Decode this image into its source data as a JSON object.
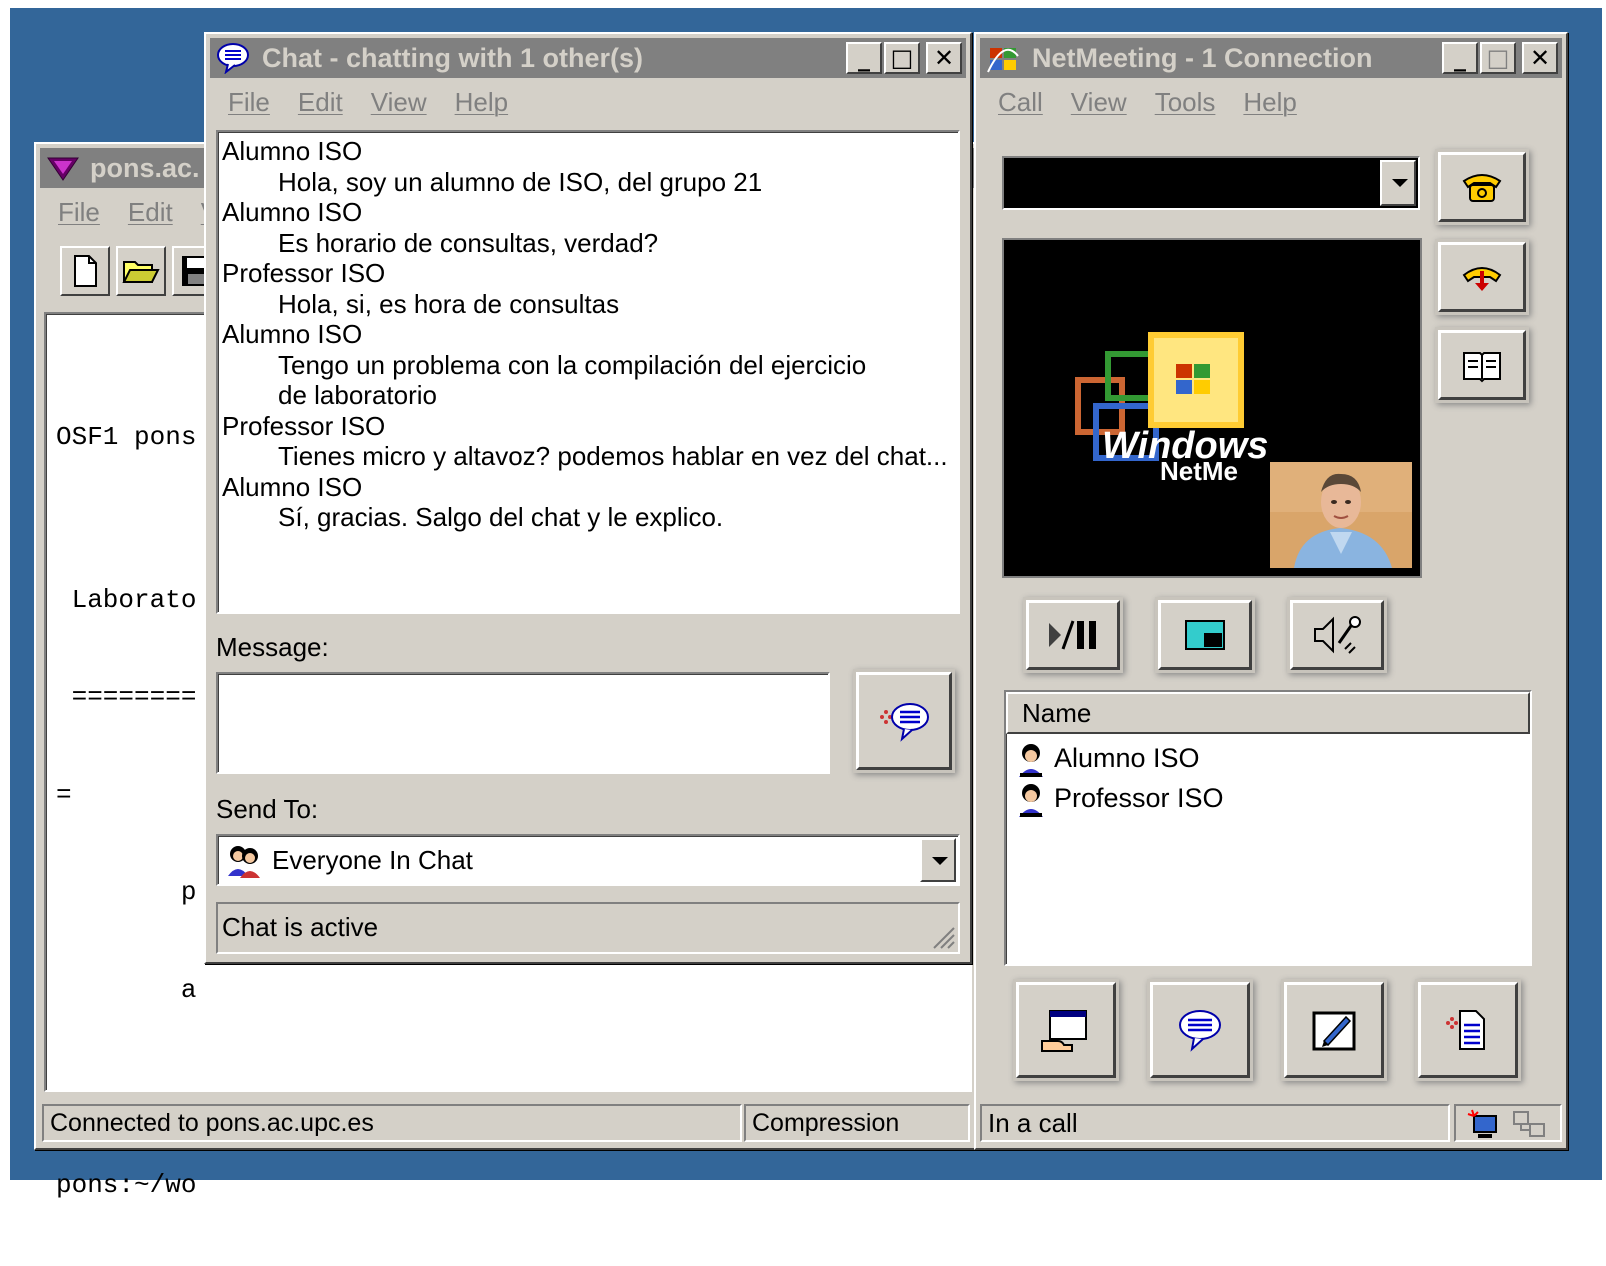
{
  "terminal": {
    "title": "pons.ac.",
    "menu": [
      "File",
      "Edit",
      "V"
    ],
    "lines": [
      "OSF1 pons",
      "",
      " Laborato",
      " ========",
      "=",
      "        p",
      "        a",
      "",
      "pons:~/wo"
    ],
    "status_connected": "Connected to pons.ac.upc.es",
    "status_compression": "Compression"
  },
  "chat": {
    "title": "Chat - chatting with 1 other(s)",
    "menu": [
      "File",
      "Edit",
      "View",
      "Help"
    ],
    "history": [
      {
        "kind": "sender",
        "text": "Alumno ISO"
      },
      {
        "kind": "msg",
        "text": "Hola, soy un alumno de ISO, del grupo 21"
      },
      {
        "kind": "sender",
        "text": "Alumno ISO"
      },
      {
        "kind": "msg",
        "text": "Es horario de consultas, verdad?"
      },
      {
        "kind": "sender",
        "text": "Professor ISO"
      },
      {
        "kind": "msg",
        "text": "Hola, si, es hora de consultas"
      },
      {
        "kind": "sender",
        "text": "Alumno ISO"
      },
      {
        "kind": "msg",
        "text": "Tengo un problema con la compilación del ejercicio de laboratorio"
      },
      {
        "kind": "sender",
        "text": "Professor ISO"
      },
      {
        "kind": "msg",
        "text": "Tienes micro y altavoz? podemos hablar en vez del chat..."
      },
      {
        "kind": "sender",
        "text": "Alumno ISO"
      },
      {
        "kind": "msg",
        "text": "Sí, gracias. Salgo del chat y le explico."
      }
    ],
    "message_label": "Message:",
    "message_value": "",
    "send_to_label": "Send To:",
    "send_to_value": "Everyone In Chat",
    "status": "Chat is active"
  },
  "netmeeting": {
    "title": "NetMeeting - 1 Connection",
    "menu": [
      "Call",
      "View",
      "Tools",
      "Help"
    ],
    "address_value": "",
    "logo_line1": "Windows",
    "logo_line2": "NetMe",
    "participants_header": "Name",
    "participants": [
      "Alumno ISO",
      "Professor ISO"
    ],
    "status": "In a call"
  },
  "colors": {
    "desktop": "#336699",
    "face": "#d4d0c8",
    "inactive_title": "#808080"
  }
}
